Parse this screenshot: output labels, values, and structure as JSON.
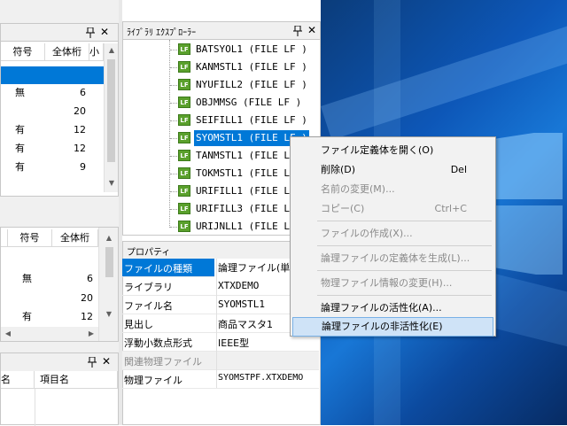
{
  "colors": {
    "selection": "#0078d7",
    "menu_highlight": "#cfe3f7",
    "lf_badge": "#5aa02c",
    "section_header": "#f0f0f0"
  },
  "top_field_panel": {
    "columns": [
      "符号",
      "全体桁",
      "小"
    ],
    "rows": [
      {
        "sign": "",
        "digits": ""
      },
      {
        "sign": "無",
        "digits": "6"
      },
      {
        "sign": "",
        "digits": "20"
      },
      {
        "sign": "有",
        "digits": "12"
      },
      {
        "sign": "有",
        "digits": "12"
      },
      {
        "sign": "有",
        "digits": "9"
      }
    ],
    "pin_icon": "pin-icon",
    "close_icon": "close-icon"
  },
  "bottom_field_panel": {
    "columns": [
      "符号",
      "全体桁"
    ],
    "rows": [
      {
        "sign": "無",
        "digits": "6"
      },
      {
        "sign": "",
        "digits": "20"
      },
      {
        "sign": "有",
        "digits": "12"
      }
    ]
  },
  "lower_left_panel": {
    "columns": [
      "名",
      "項目名"
    ]
  },
  "library_explorer": {
    "title": "ﾗｲﾌﾞﾗﾘ ｴｸｽﾌﾟﾛｰﾗｰ",
    "badge": "LF",
    "items": [
      "BATSYOL1 (FILE LF )",
      "KANMSTL1 (FILE LF )",
      "NYUFILL2 (FILE LF )",
      "OBJMMSG (FILE LF )",
      "SEIFILL1 (FILE LF )",
      "SYOMSTL1 (FILE LF )",
      "TANMSTL1 (FILE LF )",
      "TOKMSTL1 (FILE LF )",
      "URIFILL1 (FILE LF )",
      "URIFILL3 (FILE LF )",
      "URIJNLL1 (FILE LF )"
    ],
    "selected_index": 5
  },
  "properties": {
    "title": "プロパティ",
    "rows": [
      {
        "key": "ファイルの種類",
        "value": "論理ファイル(単純"
      },
      {
        "key": "ライブラリ",
        "value": "XTXDEMO"
      },
      {
        "key": "ファイル名",
        "value": "SYOMSTL1"
      },
      {
        "key": "見出し",
        "value": "商品マスタ1"
      },
      {
        "key": "浮動小数点形式",
        "value": "IEEE型"
      }
    ],
    "section": "関連物理ファイル",
    "physical_row": {
      "key": "物理ファイル",
      "value": "SYOMSTPF.XTXDEMO"
    }
  },
  "context_menu": {
    "items": [
      {
        "label": "ファイル定義体を開く(O)",
        "shortcut": "",
        "disabled": false
      },
      {
        "label": "削除(D)",
        "shortcut": "Del",
        "disabled": false
      },
      {
        "label": "名前の変更(M)...",
        "shortcut": "",
        "disabled": true
      },
      {
        "label": "コピー(C)",
        "shortcut": "Ctrl+C",
        "disabled": true
      },
      {
        "label": "ファイルの作成(X)...",
        "shortcut": "",
        "disabled": true
      },
      {
        "label": "論理ファイルの定義体を生成(L)...",
        "shortcut": "",
        "disabled": true
      },
      {
        "label": "物理ファイル情報の変更(H)...",
        "shortcut": "",
        "disabled": true
      },
      {
        "label": "論理ファイルの活性化(A)...",
        "shortcut": "",
        "disabled": false
      },
      {
        "label": "論理ファイルの非活性化(E)",
        "shortcut": "",
        "disabled": false
      }
    ]
  }
}
